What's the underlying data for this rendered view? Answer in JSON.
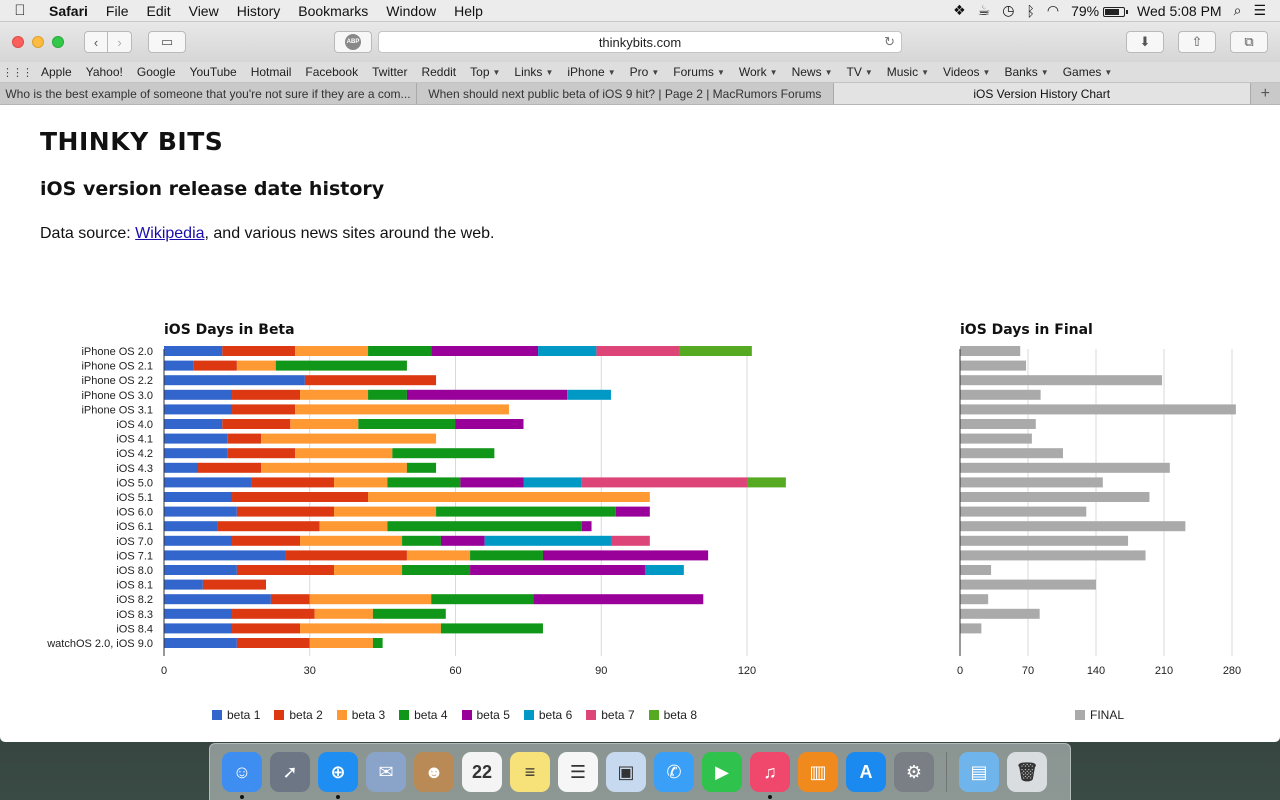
{
  "menubar": {
    "app": "Safari",
    "items": [
      "File",
      "Edit",
      "View",
      "History",
      "Bookmarks",
      "Window",
      "Help"
    ],
    "battery": "79%",
    "battery_level": 0.79,
    "clock": "Wed 5:08 PM"
  },
  "browser": {
    "url": "thinkybits.com",
    "abp_label": "ABP",
    "favorites": [
      {
        "label": "Apple",
        "menu": false
      },
      {
        "label": "Yahoo!",
        "menu": false
      },
      {
        "label": "Google",
        "menu": false
      },
      {
        "label": "YouTube",
        "menu": false
      },
      {
        "label": "Hotmail",
        "menu": false
      },
      {
        "label": "Facebook",
        "menu": false
      },
      {
        "label": "Twitter",
        "menu": false
      },
      {
        "label": "Reddit",
        "menu": false
      },
      {
        "label": "Top",
        "menu": true
      },
      {
        "label": "Links",
        "menu": true
      },
      {
        "label": "iPhone",
        "menu": true
      },
      {
        "label": "Pro",
        "menu": true
      },
      {
        "label": "Forums",
        "menu": true
      },
      {
        "label": "Work",
        "menu": true
      },
      {
        "label": "News",
        "menu": true
      },
      {
        "label": "TV",
        "menu": true
      },
      {
        "label": "Music",
        "menu": true
      },
      {
        "label": "Videos",
        "menu": true
      },
      {
        "label": "Banks",
        "menu": true
      },
      {
        "label": "Games",
        "menu": true
      }
    ],
    "tabs": [
      {
        "title": "Who is the best example of someone that you're not sure if they are a com...",
        "active": false
      },
      {
        "title": "When should next public beta of iOS 9 hit? | Page 2 | MacRumors Forums",
        "active": false
      },
      {
        "title": "iOS Version History Chart",
        "active": true
      }
    ]
  },
  "page": {
    "site_title": "THINKY BITS",
    "heading": "iOS version release date history",
    "source_prefix": "Data source: ",
    "source_link": "Wikipedia",
    "source_suffix": ", and various news sites around the web."
  },
  "colors": {
    "beta 1": "#3366cc",
    "beta 2": "#dc3912",
    "beta 3": "#ff9933",
    "beta 4": "#109618",
    "beta 5": "#990099",
    "beta 6": "#0099c6",
    "beta 7": "#dd4477",
    "beta 8": "#55aa22",
    "FINAL": "#aaaaaa"
  },
  "chart_data": [
    {
      "type": "bar",
      "stacked": true,
      "orientation": "horizontal",
      "title": "iOS Days in Beta",
      "xlim": [
        0,
        130
      ],
      "xticks": [
        0,
        30,
        60,
        90,
        120
      ],
      "grid": true,
      "legend": "bottom",
      "categories": [
        "iPhone OS 2.0",
        "iPhone OS 2.1",
        "iPhone OS 2.2",
        "iPhone OS 3.0",
        "iPhone OS 3.1",
        "iOS 4.0",
        "iOS 4.1",
        "iOS 4.2",
        "iOS 4.3",
        "iOS 5.0",
        "iOS 5.1",
        "iOS 6.0",
        "iOS 6.1",
        "iOS 7.0",
        "iOS 7.1",
        "iOS 8.0",
        "iOS 8.1",
        "iOS 8.2",
        "iOS 8.3",
        "iOS 8.4",
        "watchOS 2.0, iOS 9.0"
      ],
      "series": [
        {
          "name": "beta 1",
          "values": [
            12,
            6,
            29,
            14,
            14,
            12,
            13,
            13,
            7,
            18,
            14,
            15,
            11,
            14,
            25,
            15,
            8,
            22,
            14,
            14,
            15
          ]
        },
        {
          "name": "beta 2",
          "values": [
            15,
            9,
            27,
            14,
            13,
            14,
            7,
            14,
            13,
            17,
            28,
            20,
            21,
            14,
            25,
            20,
            13,
            8,
            17,
            14,
            15
          ]
        },
        {
          "name": "beta 3",
          "values": [
            15,
            8,
            0,
            14,
            44,
            14,
            36,
            20,
            30,
            11,
            58,
            21,
            14,
            21,
            13,
            14,
            0,
            25,
            12,
            29,
            13
          ]
        },
        {
          "name": "beta 4",
          "values": [
            13,
            27,
            0,
            8,
            0,
            20,
            0,
            21,
            6,
            15,
            0,
            37,
            40,
            8,
            15,
            14,
            0,
            21,
            15,
            21,
            2
          ]
        },
        {
          "name": "beta 5",
          "values": [
            22,
            0,
            0,
            33,
            0,
            14,
            0,
            0,
            0,
            13,
            0,
            7,
            2,
            9,
            34,
            36,
            0,
            35,
            0,
            0,
            0
          ]
        },
        {
          "name": "beta 6",
          "values": [
            12,
            0,
            0,
            9,
            0,
            0,
            0,
            0,
            0,
            12,
            0,
            0,
            0,
            26,
            0,
            8,
            0,
            0,
            0,
            0,
            0
          ]
        },
        {
          "name": "beta 7",
          "values": [
            17,
            0,
            0,
            0,
            0,
            0,
            0,
            0,
            0,
            34,
            0,
            0,
            0,
            8,
            0,
            0,
            0,
            0,
            0,
            0,
            0
          ]
        },
        {
          "name": "beta 8",
          "values": [
            15,
            0,
            0,
            0,
            0,
            0,
            0,
            0,
            0,
            8,
            0,
            0,
            0,
            0,
            0,
            0,
            0,
            0,
            0,
            0,
            0
          ]
        }
      ]
    },
    {
      "type": "bar",
      "orientation": "horizontal",
      "title": "iOS Days in Final",
      "xlim": [
        0,
        300
      ],
      "xticks": [
        0,
        70,
        140,
        210,
        280
      ],
      "grid": true,
      "legend": "bottom",
      "categories": [
        "iPhone OS 2.0",
        "iPhone OS 2.1",
        "iPhone OS 2.2",
        "iPhone OS 3.0",
        "iPhone OS 3.1",
        "iOS 4.0",
        "iOS 4.1",
        "iOS 4.2",
        "iOS 4.3",
        "iOS 5.0",
        "iOS 5.1",
        "iOS 6.0",
        "iOS 6.1",
        "iOS 7.0",
        "iOS 7.1",
        "iOS 8.0",
        "iOS 8.1",
        "iOS 8.2",
        "iOS 8.3",
        "iOS 8.4",
        "watchOS 2.0, iOS 9.0"
      ],
      "series": [
        {
          "name": "FINAL",
          "values": [
            62,
            68,
            208,
            83,
            284,
            78,
            74,
            106,
            216,
            147,
            195,
            130,
            232,
            173,
            191,
            32,
            140,
            29,
            82,
            22,
            0
          ]
        }
      ]
    }
  ],
  "dock": {
    "apps": [
      {
        "name": "finder-icon",
        "glyph": "☺",
        "color": "#3d8ef0",
        "running": true
      },
      {
        "name": "launchpad-icon",
        "glyph": "➚",
        "color": "#6c7684",
        "running": false
      },
      {
        "name": "safari-icon",
        "glyph": "⊕",
        "color": "#1f8ef2",
        "running": true
      },
      {
        "name": "mail-stamp-icon",
        "glyph": "✉",
        "color": "#8aa3c8",
        "running": false
      },
      {
        "name": "contacts-icon",
        "glyph": "☻",
        "color": "#b98a55",
        "running": false
      },
      {
        "name": "calendar-icon",
        "glyph": "22",
        "color": "#f4f4f4",
        "running": false
      },
      {
        "name": "notes-icon",
        "glyph": "≡",
        "color": "#f7e27a",
        "running": false
      },
      {
        "name": "reminders-icon",
        "glyph": "☰",
        "color": "#f6f6f6",
        "running": false
      },
      {
        "name": "photo-slideshow-icon",
        "glyph": "▣",
        "color": "#c7d9ef",
        "running": false
      },
      {
        "name": "messages-icon",
        "glyph": "✆",
        "color": "#3aa0f7",
        "running": false
      },
      {
        "name": "facetime-icon",
        "glyph": "▶",
        "color": "#2fc24c",
        "running": false
      },
      {
        "name": "itunes-icon",
        "glyph": "♫",
        "color": "#f0476c",
        "running": true
      },
      {
        "name": "ibooks-icon",
        "glyph": "▥",
        "color": "#f08a1c",
        "running": false
      },
      {
        "name": "app-store-icon",
        "glyph": "A",
        "color": "#1b8af0",
        "running": false
      },
      {
        "name": "system-preferences-icon",
        "glyph": "⚙",
        "color": "#7a7f86",
        "running": false
      }
    ],
    "trailing": [
      {
        "name": "downloads-folder-icon",
        "glyph": "▤",
        "color": "#6fb5ec"
      },
      {
        "name": "trash-icon",
        "glyph": "🗑",
        "color": "#d9dde0"
      }
    ]
  }
}
